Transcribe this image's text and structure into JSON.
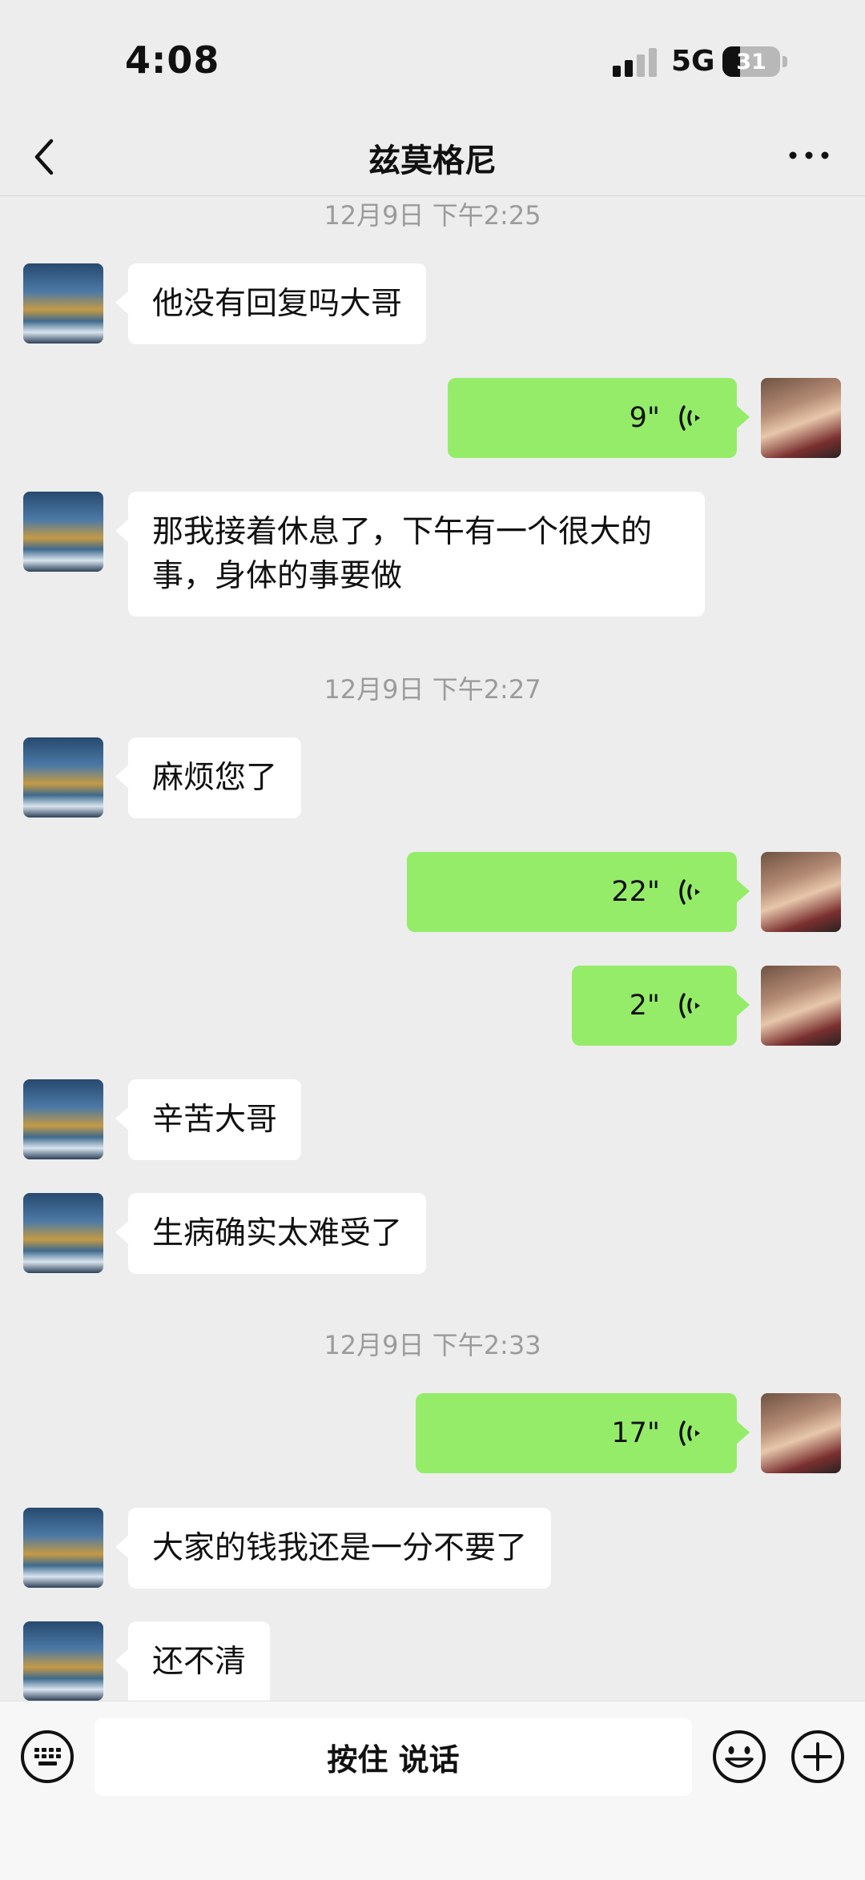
{
  "status_bar": {
    "time": "4:08",
    "network": "5G",
    "battery": "31",
    "battery_level": 0.31
  },
  "header": {
    "title": "兹莫格尼"
  },
  "messages": [
    {
      "kind": "timestamp",
      "text": "12月9日 下午2:25"
    },
    {
      "kind": "text",
      "side": "left",
      "text": "他没有回复吗大哥"
    },
    {
      "kind": "voice",
      "side": "right",
      "duration": "9\""
    },
    {
      "kind": "text",
      "side": "left",
      "text": "那我接着休息了，下午有一个很大的事，身体的事要做"
    },
    {
      "kind": "timestamp",
      "text": "12月9日 下午2:27"
    },
    {
      "kind": "text",
      "side": "left",
      "text": "麻烦您了"
    },
    {
      "kind": "voice",
      "side": "right",
      "duration": "22\""
    },
    {
      "kind": "voice",
      "side": "right",
      "duration": "2\""
    },
    {
      "kind": "text",
      "side": "left",
      "text": "辛苦大哥"
    },
    {
      "kind": "text",
      "side": "left",
      "text": "生病确实太难受了"
    },
    {
      "kind": "timestamp",
      "text": "12月9日 下午2:33"
    },
    {
      "kind": "voice",
      "side": "right",
      "duration": "17\""
    },
    {
      "kind": "text",
      "side": "left",
      "text": "大家的钱我还是一分不要了"
    },
    {
      "kind": "text",
      "side": "left",
      "text": "还不清"
    }
  ],
  "input_bar": {
    "hold_to_talk": "按住 说话",
    "icons": [
      "keyboard-icon",
      "emoji-icon",
      "plus-icon"
    ]
  },
  "colors": {
    "background": "#ededed",
    "sent_bubble": "#95ec69",
    "received_bubble": "#ffffff",
    "timestamp": "#9b9b9b"
  }
}
